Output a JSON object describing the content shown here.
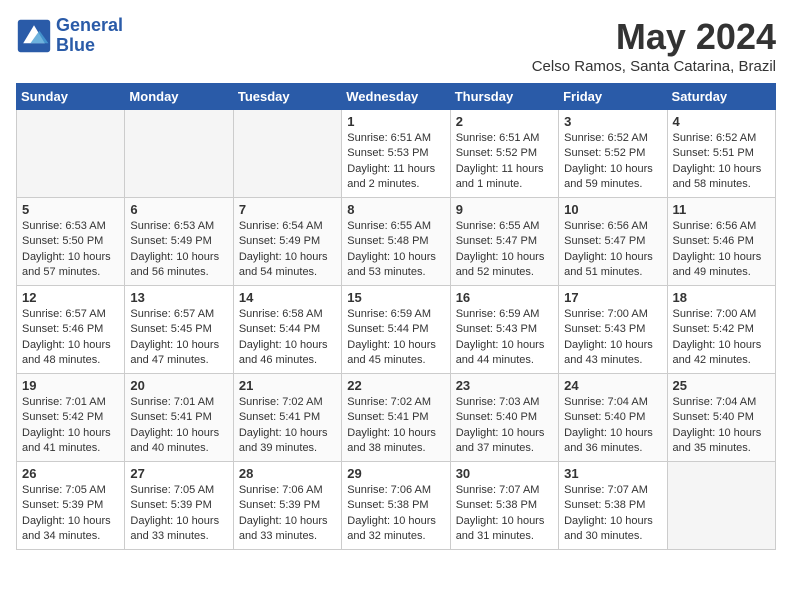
{
  "header": {
    "logo_line1": "General",
    "logo_line2": "Blue",
    "month": "May 2024",
    "location": "Celso Ramos, Santa Catarina, Brazil"
  },
  "weekdays": [
    "Sunday",
    "Monday",
    "Tuesday",
    "Wednesday",
    "Thursday",
    "Friday",
    "Saturday"
  ],
  "weeks": [
    [
      {
        "day": "",
        "empty": true
      },
      {
        "day": "",
        "empty": true
      },
      {
        "day": "",
        "empty": true
      },
      {
        "day": "1",
        "sunrise": "6:51 AM",
        "sunset": "5:53 PM",
        "daylight": "11 hours and 2 minutes."
      },
      {
        "day": "2",
        "sunrise": "6:51 AM",
        "sunset": "5:52 PM",
        "daylight": "11 hours and 1 minute."
      },
      {
        "day": "3",
        "sunrise": "6:52 AM",
        "sunset": "5:52 PM",
        "daylight": "10 hours and 59 minutes."
      },
      {
        "day": "4",
        "sunrise": "6:52 AM",
        "sunset": "5:51 PM",
        "daylight": "10 hours and 58 minutes."
      }
    ],
    [
      {
        "day": "5",
        "sunrise": "6:53 AM",
        "sunset": "5:50 PM",
        "daylight": "10 hours and 57 minutes."
      },
      {
        "day": "6",
        "sunrise": "6:53 AM",
        "sunset": "5:49 PM",
        "daylight": "10 hours and 56 minutes."
      },
      {
        "day": "7",
        "sunrise": "6:54 AM",
        "sunset": "5:49 PM",
        "daylight": "10 hours and 54 minutes."
      },
      {
        "day": "8",
        "sunrise": "6:55 AM",
        "sunset": "5:48 PM",
        "daylight": "10 hours and 53 minutes."
      },
      {
        "day": "9",
        "sunrise": "6:55 AM",
        "sunset": "5:47 PM",
        "daylight": "10 hours and 52 minutes."
      },
      {
        "day": "10",
        "sunrise": "6:56 AM",
        "sunset": "5:47 PM",
        "daylight": "10 hours and 51 minutes."
      },
      {
        "day": "11",
        "sunrise": "6:56 AM",
        "sunset": "5:46 PM",
        "daylight": "10 hours and 49 minutes."
      }
    ],
    [
      {
        "day": "12",
        "sunrise": "6:57 AM",
        "sunset": "5:46 PM",
        "daylight": "10 hours and 48 minutes."
      },
      {
        "day": "13",
        "sunrise": "6:57 AM",
        "sunset": "5:45 PM",
        "daylight": "10 hours and 47 minutes."
      },
      {
        "day": "14",
        "sunrise": "6:58 AM",
        "sunset": "5:44 PM",
        "daylight": "10 hours and 46 minutes."
      },
      {
        "day": "15",
        "sunrise": "6:59 AM",
        "sunset": "5:44 PM",
        "daylight": "10 hours and 45 minutes."
      },
      {
        "day": "16",
        "sunrise": "6:59 AM",
        "sunset": "5:43 PM",
        "daylight": "10 hours and 44 minutes."
      },
      {
        "day": "17",
        "sunrise": "7:00 AM",
        "sunset": "5:43 PM",
        "daylight": "10 hours and 43 minutes."
      },
      {
        "day": "18",
        "sunrise": "7:00 AM",
        "sunset": "5:42 PM",
        "daylight": "10 hours and 42 minutes."
      }
    ],
    [
      {
        "day": "19",
        "sunrise": "7:01 AM",
        "sunset": "5:42 PM",
        "daylight": "10 hours and 41 minutes."
      },
      {
        "day": "20",
        "sunrise": "7:01 AM",
        "sunset": "5:41 PM",
        "daylight": "10 hours and 40 minutes."
      },
      {
        "day": "21",
        "sunrise": "7:02 AM",
        "sunset": "5:41 PM",
        "daylight": "10 hours and 39 minutes."
      },
      {
        "day": "22",
        "sunrise": "7:02 AM",
        "sunset": "5:41 PM",
        "daylight": "10 hours and 38 minutes."
      },
      {
        "day": "23",
        "sunrise": "7:03 AM",
        "sunset": "5:40 PM",
        "daylight": "10 hours and 37 minutes."
      },
      {
        "day": "24",
        "sunrise": "7:04 AM",
        "sunset": "5:40 PM",
        "daylight": "10 hours and 36 minutes."
      },
      {
        "day": "25",
        "sunrise": "7:04 AM",
        "sunset": "5:40 PM",
        "daylight": "10 hours and 35 minutes."
      }
    ],
    [
      {
        "day": "26",
        "sunrise": "7:05 AM",
        "sunset": "5:39 PM",
        "daylight": "10 hours and 34 minutes."
      },
      {
        "day": "27",
        "sunrise": "7:05 AM",
        "sunset": "5:39 PM",
        "daylight": "10 hours and 33 minutes."
      },
      {
        "day": "28",
        "sunrise": "7:06 AM",
        "sunset": "5:39 PM",
        "daylight": "10 hours and 33 minutes."
      },
      {
        "day": "29",
        "sunrise": "7:06 AM",
        "sunset": "5:38 PM",
        "daylight": "10 hours and 32 minutes."
      },
      {
        "day": "30",
        "sunrise": "7:07 AM",
        "sunset": "5:38 PM",
        "daylight": "10 hours and 31 minutes."
      },
      {
        "day": "31",
        "sunrise": "7:07 AM",
        "sunset": "5:38 PM",
        "daylight": "10 hours and 30 minutes."
      },
      {
        "day": "",
        "empty": true
      }
    ]
  ]
}
